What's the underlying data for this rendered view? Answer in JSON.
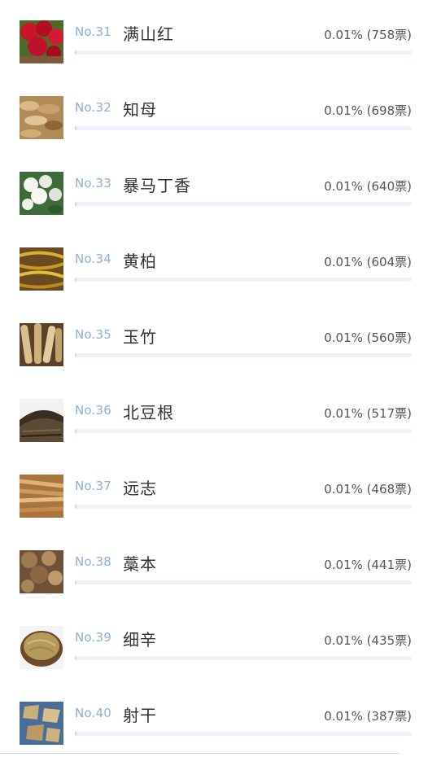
{
  "items": [
    {
      "rank": "No.31",
      "name": "满山红",
      "stat": "0.01% (758票)",
      "share": 0.0001,
      "image": "red-flowers-photo"
    },
    {
      "rank": "No.32",
      "name": "知母",
      "stat": "0.01% (698票)",
      "share": 0.0001,
      "image": "dried-slices-photo"
    },
    {
      "rank": "No.33",
      "name": "暴马丁香",
      "stat": "0.01% (640票)",
      "share": 0.0001,
      "image": "white-blossom-photo"
    },
    {
      "rank": "No.34",
      "name": "黄柏",
      "stat": "0.01% (604票)",
      "share": 0.0001,
      "image": "yellow-bark-strips-photo"
    },
    {
      "rank": "No.35",
      "name": "玉竹",
      "stat": "0.01% (560票)",
      "share": 0.0001,
      "image": "rhizome-pieces-photo"
    },
    {
      "rank": "No.36",
      "name": "北豆根",
      "stat": "0.01% (517票)",
      "share": 0.0001,
      "image": "dark-root-pile-photo"
    },
    {
      "rank": "No.37",
      "name": "远志",
      "stat": "0.01% (468票)",
      "share": 0.0001,
      "image": "tan-root-sticks-photo"
    },
    {
      "rank": "No.38",
      "name": "藁本",
      "stat": "0.01% (441票)",
      "share": 0.0001,
      "image": "brown-root-chunks-photo"
    },
    {
      "rank": "No.39",
      "name": "细辛",
      "stat": "0.01% (435票)",
      "share": 0.0001,
      "image": "fine-roots-bowl-photo"
    },
    {
      "rank": "No.40",
      "name": "射干",
      "stat": "0.01% (387票)",
      "share": 0.0001,
      "image": "slices-on-blue-photo"
    }
  ],
  "colors": {
    "rank_text": "#8fb0d8",
    "bar_track": "#edf2f8",
    "bar_fill": "#c6d8ee"
  }
}
